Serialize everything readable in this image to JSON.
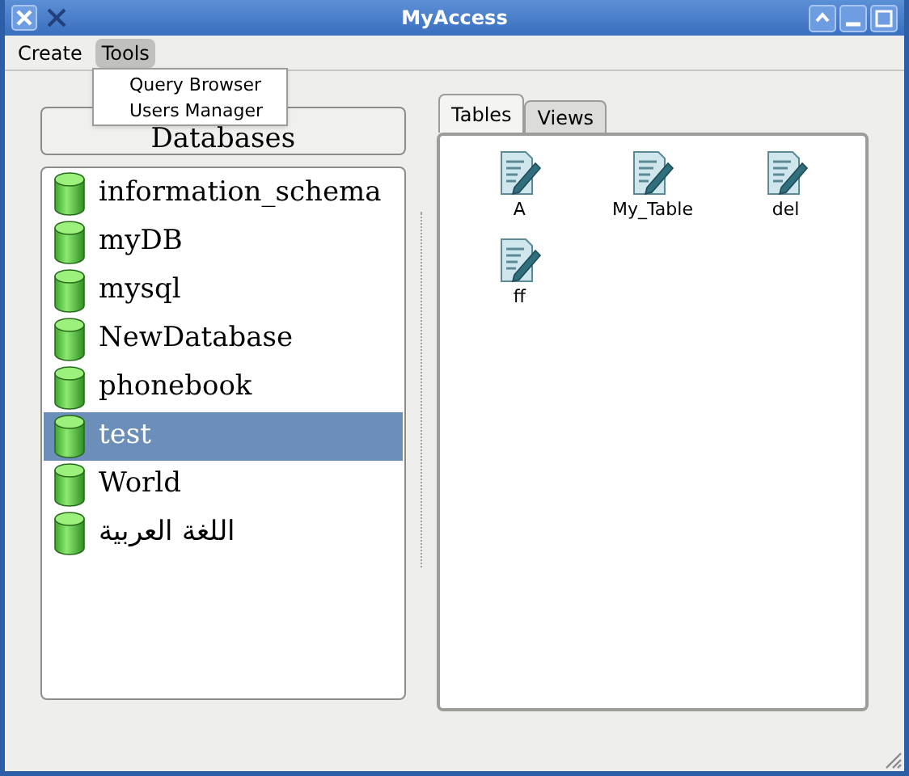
{
  "window": {
    "title": "MyAccess"
  },
  "menu": [
    {
      "label": "Create",
      "selected": false
    },
    {
      "label": "Tools",
      "selected": true
    }
  ],
  "dropdown": [
    "Query Browser",
    "Users Manager"
  ],
  "databases_button": "Databases",
  "databases": [
    {
      "name": "information_schema",
      "selected": false
    },
    {
      "name": "myDB",
      "selected": false
    },
    {
      "name": "mysql",
      "selected": false
    },
    {
      "name": "NewDatabase",
      "selected": false
    },
    {
      "name": "phonebook",
      "selected": false
    },
    {
      "name": "test",
      "selected": true
    },
    {
      "name": "World",
      "selected": false
    },
    {
      "name": "اللغة العربية",
      "selected": false
    }
  ],
  "tabs": [
    {
      "label": "Tables",
      "selected": true
    },
    {
      "label": "Views",
      "selected": false
    }
  ],
  "tables": [
    "A",
    "My_Table",
    "del",
    "ff"
  ]
}
